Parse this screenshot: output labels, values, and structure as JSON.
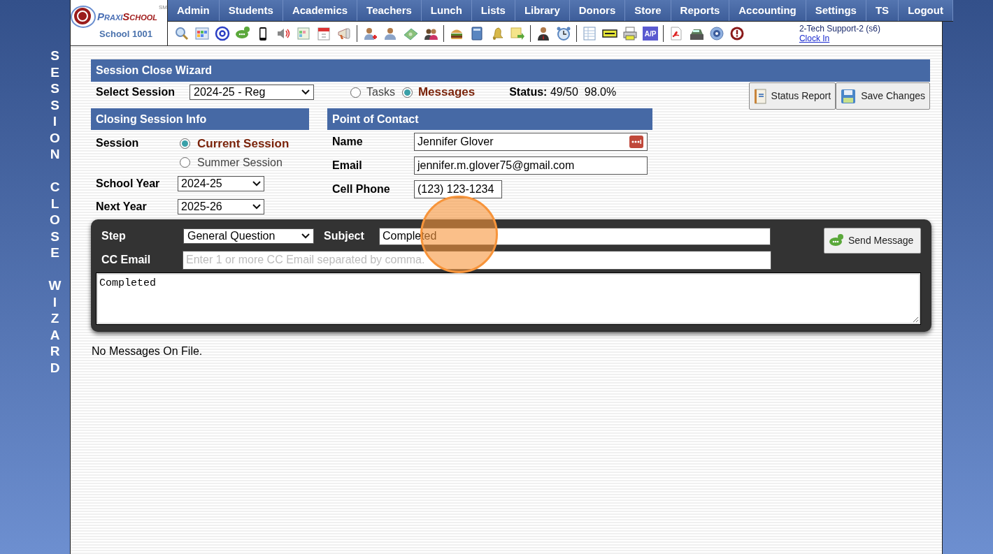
{
  "logo": {
    "brand_first": "Praxi",
    "brand_second": "School",
    "trademark": "SM",
    "school": "School 1001"
  },
  "nav": [
    "Admin",
    "Students",
    "Academics",
    "Teachers",
    "Lunch",
    "Lists",
    "Library",
    "Donors",
    "Store",
    "Reports",
    "Accounting",
    "Settings",
    "TS",
    "Logout"
  ],
  "toolbar": {
    "ap_label": "A/P"
  },
  "user": {
    "name": "2-Tech Support-2 (s6)",
    "link": "Clock In"
  },
  "side_title": "SESSION CLOSE WIZARD",
  "wizard": {
    "title": "Session Close Wizard",
    "select_label": "Select Session",
    "session": "2024-25 - Reg",
    "views": [
      {
        "label": "Tasks",
        "selected": false
      },
      {
        "label": "Messages",
        "selected": true
      }
    ],
    "status_label": "Status:",
    "status_value": "49/50  98.0%"
  },
  "buttons": [
    {
      "kind": "report",
      "label": "Status Report"
    },
    {
      "kind": "save",
      "label": "Save Changes"
    }
  ],
  "closing_info": {
    "title": "Closing Session Info",
    "session_label": "Session",
    "sessions": [
      {
        "label": "Current Session",
        "selected": true
      },
      {
        "label": "Summer Session",
        "selected": false
      }
    ],
    "school_year_label": "School Year",
    "school_year": "2024-25",
    "next_year_label": "Next Year",
    "next_year": "2025-26"
  },
  "contact": {
    "title": "Point of Contact",
    "fields": [
      {
        "kind": "name",
        "label": "Name",
        "value": "Jennifer Glover"
      },
      {
        "kind": "email",
        "label": "Email",
        "value": "jennifer.m.glover75@gmail.com"
      },
      {
        "kind": "phone",
        "label": "Cell Phone",
        "value": "(123) 123-1234"
      }
    ]
  },
  "message": {
    "step_label": "Step",
    "step": "General Question",
    "subject_label": "Subject",
    "subject": "Completed",
    "cc_label": "CC Email",
    "cc_placeholder": "Enter 1 or more CC Email separated by comma.",
    "body": "Completed",
    "send_button": "Send Message"
  },
  "empty_note": "No Messages On File."
}
